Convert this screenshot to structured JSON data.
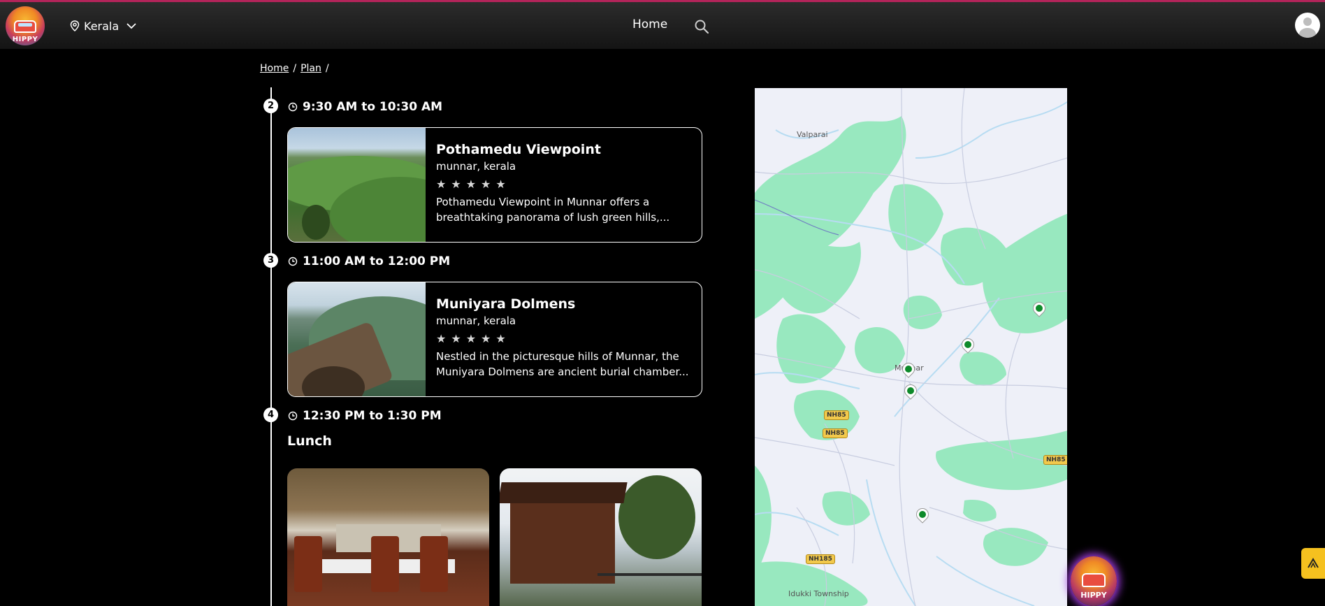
{
  "header": {
    "logo_text": "HIPPY",
    "location": "Kerala",
    "nav_home": "Home"
  },
  "breadcrumb": {
    "items": [
      "Home",
      "Plan"
    ],
    "separator": "/"
  },
  "itinerary": [
    {
      "step": "2",
      "time": "9:30 AM to 10:30 AM",
      "title": "Pothamedu Viewpoint",
      "location": "munnar, kerala",
      "rating_max": 5,
      "description_line1": "Pothamedu Viewpoint in Munnar offers a",
      "description_line2": "breathtaking panorama of lush green hills,..."
    },
    {
      "step": "3",
      "time": "11:00 AM to 12:00 PM",
      "title": "Muniyara Dolmens",
      "location": "munnar, kerala",
      "rating_max": 5,
      "description_line1": "Nestled in the picturesque hills of Munnar, the",
      "description_line2": "Muniyara Dolmens are ancient burial chamber..."
    },
    {
      "step": "4",
      "time": "12:30 PM to 1:30 PM",
      "meal_label": "Lunch"
    }
  ],
  "map": {
    "labels": {
      "valparai": "Valparai",
      "munnar": "Munnar",
      "idukki": "Idukki Township"
    },
    "road_shields": {
      "nh85_a": "NH85",
      "nh85_b": "NH85",
      "nh85_c": "NH85",
      "nh185": "NH185"
    },
    "marker_color": "#0e8a2a",
    "forest_color": "#98e8bf",
    "water_color": "#b7dcf2"
  },
  "chatbot": {
    "label": "HIPPY"
  },
  "colors": {
    "accent_line": "#b3245a",
    "side_button": "#f5c11f"
  }
}
